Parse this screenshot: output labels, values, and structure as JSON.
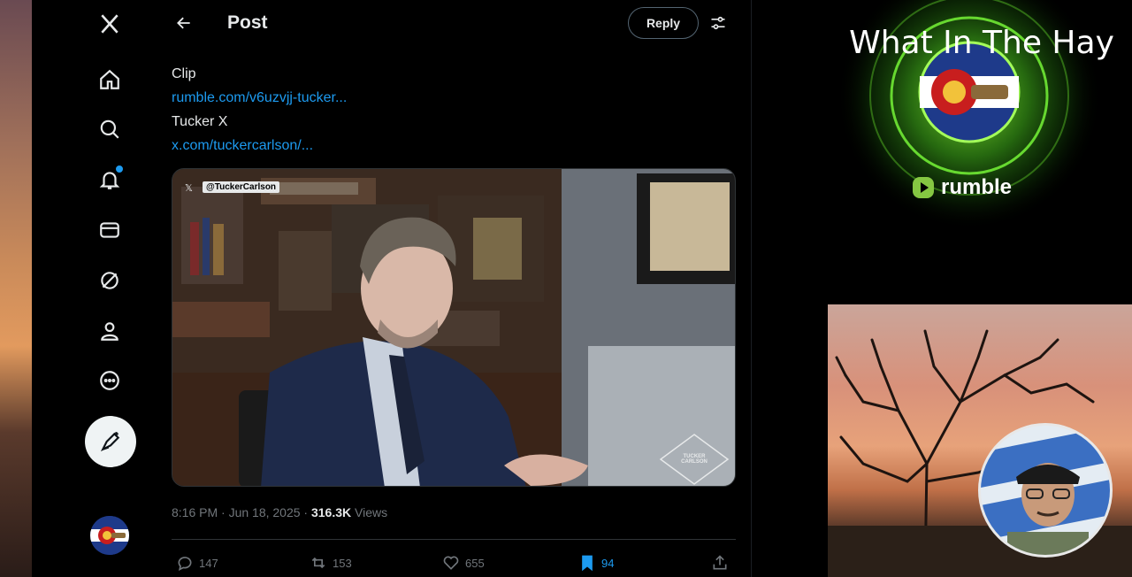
{
  "app": {
    "title": "Post"
  },
  "header": {
    "title": "Post",
    "reply_label": "Reply"
  },
  "post": {
    "line1": "Clip",
    "link1": "rumble.com/v6uzvjj-tucker...",
    "line2": "Tucker X",
    "link2": "x.com/tuckercarlson/...",
    "media_label": "@TuckerCarlson",
    "media_watermark": "TUCKER CARLSON",
    "time": "8:16 PM · Jun 18, 2025 · ",
    "views_count": "316.3K",
    "views_label": " Views"
  },
  "actions": {
    "replies": "147",
    "reposts": "153",
    "likes": "655",
    "bookmarks": "94"
  },
  "promo": {
    "title": "What In The Hay",
    "brand": "rumble"
  },
  "colors": {
    "accent": "#1d9bf0",
    "background": "#000000",
    "muted": "#71767b",
    "rumble_green": "#85c742"
  },
  "nav": {
    "icons": [
      "x-logo-icon",
      "home-icon",
      "search-icon",
      "notifications-icon",
      "messages-icon",
      "grok-icon",
      "profile-icon",
      "more-icon",
      "compose-icon"
    ]
  }
}
